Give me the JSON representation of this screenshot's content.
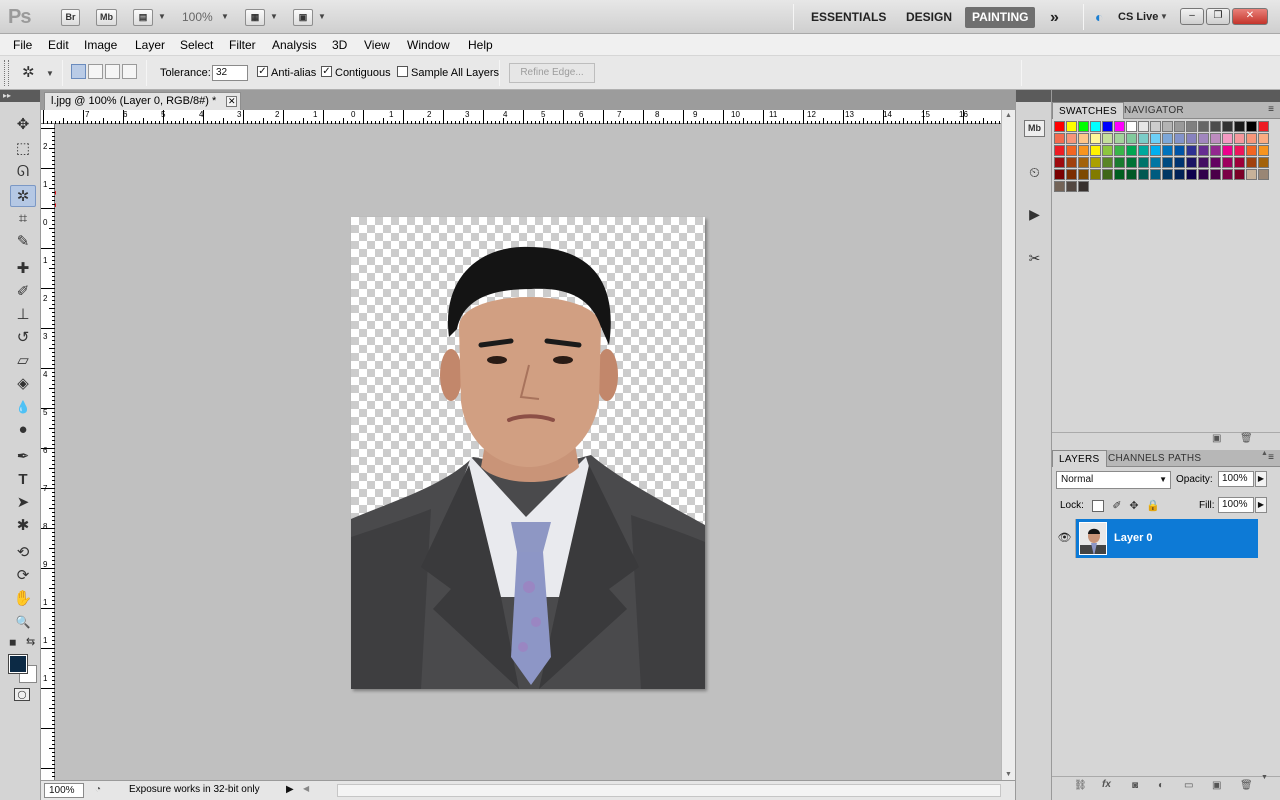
{
  "app": {
    "logo": "Ps",
    "launchers": [
      "Br",
      "Mb"
    ],
    "zoom": "100%",
    "workspaces": [
      "ESSENTIALS",
      "DESIGN",
      "PAINTING"
    ],
    "active_workspace": "PAINTING",
    "more": "»",
    "cs_live": "CS Live",
    "window_controls": {
      "minimize": "–",
      "restore": "❐",
      "close": "✕"
    }
  },
  "menu": [
    "File",
    "Edit",
    "Image",
    "Layer",
    "Select",
    "Filter",
    "Analysis",
    "3D",
    "View",
    "Window",
    "Help"
  ],
  "options": {
    "tolerance_label": "Tolerance:",
    "tolerance_value": "32",
    "anti_alias": {
      "label": "Anti-alias",
      "checked": true
    },
    "contiguous": {
      "label": "Contiguous",
      "checked": true
    },
    "sample_all_layers": {
      "label": "Sample All Layers",
      "checked": false
    },
    "refine_edge": "Refine Edge..."
  },
  "document": {
    "tab_title": "l.jpg @ 100% (Layer 0, RGB/8#) *",
    "close": "✕",
    "status_zoom": "100%",
    "status_info": "Exposure works in 32-bit only"
  },
  "rulers": {
    "horizontal": [
      "7",
      "6",
      "5",
      "4",
      "3",
      "2",
      "1",
      "0",
      "1",
      "2",
      "3",
      "4",
      "5",
      "6",
      "7",
      "8",
      "9",
      "10",
      "11",
      "12",
      "13",
      "14",
      "15",
      "16"
    ],
    "vertical": [
      "2",
      "1",
      "0",
      "1",
      "2",
      "3",
      "4",
      "5",
      "6",
      "7",
      "8",
      "9",
      "1",
      "1",
      "1"
    ]
  },
  "tools": [
    {
      "name": "move-tool-icon",
      "glyph": "✥"
    },
    {
      "name": "marquee-tool-icon",
      "glyph": "⬚"
    },
    {
      "name": "lasso-tool-icon",
      "glyph": "ᘏ"
    },
    {
      "name": "magic-wand-tool-icon",
      "glyph": "✲",
      "selected": true
    },
    {
      "name": "crop-tool-icon",
      "glyph": "⌗"
    },
    {
      "name": "eyedropper-tool-icon",
      "glyph": "✎"
    },
    {
      "name": "healing-brush-tool-icon",
      "glyph": "✚"
    },
    {
      "name": "brush-tool-icon",
      "glyph": "✐"
    },
    {
      "name": "clone-stamp-tool-icon",
      "glyph": "⊥"
    },
    {
      "name": "history-brush-tool-icon",
      "glyph": "↺"
    },
    {
      "name": "eraser-tool-icon",
      "glyph": "▱"
    },
    {
      "name": "paint-bucket-tool-icon",
      "glyph": "◈"
    },
    {
      "name": "blur-tool-icon",
      "glyph": "💧"
    },
    {
      "name": "dodge-tool-icon",
      "glyph": "●"
    },
    {
      "name": "pen-tool-icon",
      "glyph": "✒"
    },
    {
      "name": "type-tool-icon",
      "glyph": "T"
    },
    {
      "name": "path-selection-tool-icon",
      "glyph": "➤"
    },
    {
      "name": "shape-tool-icon",
      "glyph": "✱"
    },
    {
      "name": "3d-rotate-tool-icon",
      "glyph": "⟲"
    },
    {
      "name": "3d-orbit-tool-icon",
      "glyph": "⟳"
    },
    {
      "name": "hand-tool-icon",
      "glyph": "✋"
    },
    {
      "name": "zoom-tool-icon",
      "glyph": "🔍"
    }
  ],
  "colors": {
    "foreground": "#0c2a45",
    "background": "#ffffff",
    "selection_highlight": "#0d7ad6",
    "annotation_arrow": "#e0161b"
  },
  "dock_icons": [
    "Mb",
    "history-icon",
    "actions-icon",
    "tool-presets-icon"
  ],
  "swatches": {
    "tabs": [
      "SWATCHES",
      "NAVIGATOR"
    ],
    "active_tab": "SWATCHES",
    "rows": [
      [
        "#ff0000",
        "#ffff00",
        "#00ff00",
        "#00ffff",
        "#0000ff",
        "#ff00ff",
        "#ffffff",
        "#e6e6e6",
        "#cccccc",
        "#b3b3b3",
        "#999999",
        "#808080",
        "#666666",
        "#4d4d4d",
        "#333333",
        "#1a1a1a",
        "#000000",
        "#ed1c24"
      ],
      [
        "#f26c4f",
        "#f69679",
        "#fdc689",
        "#fff799",
        "#c4df9b",
        "#a3d39c",
        "#82ca9d",
        "#7accc8",
        "#6dcff6",
        "#7da7d8",
        "#8393ca",
        "#8882be",
        "#a186be",
        "#bd8cbf",
        "#f49ac2",
        "#f5989d",
        "#f7977a",
        "#fbad82"
      ],
      [
        "#ed1c24",
        "#f26522",
        "#f7941d",
        "#fff200",
        "#8dc63f",
        "#39b54a",
        "#00a651",
        "#00a99d",
        "#00aeef",
        "#0072bc",
        "#0054a6",
        "#2e3192",
        "#662d91",
        "#92278f",
        "#ec008c",
        "#ed145b",
        "#f26522",
        "#f7941d"
      ],
      [
        "#9e0b0f",
        "#a0410d",
        "#a3620a",
        "#aba000",
        "#598527",
        "#197b30",
        "#007236",
        "#00746b",
        "#0076a3",
        "#004a80",
        "#003471",
        "#1b1464",
        "#440e62",
        "#630460",
        "#9e005d",
        "#9e0039",
        "#a0410d",
        "#a3620a"
      ],
      [
        "#790000",
        "#7b2e00",
        "#7d4900",
        "#827b00",
        "#406618",
        "#005e20",
        "#005826",
        "#005952",
        "#005b7f",
        "#003663",
        "#002157",
        "#0d004c",
        "#32004b",
        "#4b0049",
        "#7b0046",
        "#7a0026",
        "#c7b299",
        "#998675"
      ],
      [
        "#736357",
        "#534741",
        "#37302d"
      ]
    ]
  },
  "layers": {
    "tabs": [
      "LAYERS",
      "CHANNELS",
      "PATHS"
    ],
    "active_tab": "LAYERS",
    "blend_mode": "Normal",
    "opacity_label": "Opacity:",
    "opacity": "100%",
    "lock_label": "Lock:",
    "fill_label": "Fill:",
    "fill": "100%",
    "items": [
      {
        "name": "Layer 0",
        "visible": true,
        "selected": true
      }
    ],
    "footer_icons": [
      "link-icon",
      "fx-icon",
      "mask-icon",
      "adjustment-icon",
      "group-icon",
      "new-layer-icon",
      "trash-icon"
    ]
  }
}
